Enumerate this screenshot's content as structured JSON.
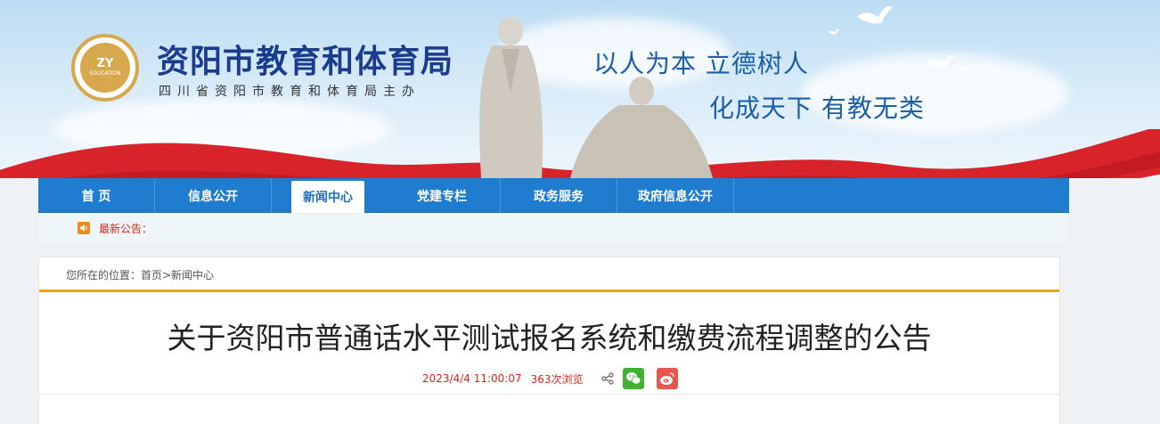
{
  "header": {
    "logo_top": "ZY",
    "logo_bottom": "EDUCATION",
    "site_title": "资阳市教育和体育局",
    "site_subtitle": "四川省资阳市教育和体育局主办",
    "slogan_line1": "以人为本 立德树人",
    "slogan_line2": "化成天下 有教无类"
  },
  "nav": {
    "items": [
      {
        "label": "首 页"
      },
      {
        "label": "信息公开"
      },
      {
        "label": "新闻中心"
      },
      {
        "label": "党建专栏"
      },
      {
        "label": "政务服务"
      },
      {
        "label": "政府信息公开"
      }
    ],
    "active_index": 2
  },
  "notice": {
    "label": "最新公告："
  },
  "breadcrumb": {
    "text": "您所在的位置：首页>新闻中心"
  },
  "article": {
    "title": "关于资阳市普通话水平测试报名系统和缴费流程调整的公告",
    "datetime": "2023/4/4 11:00:07",
    "views": "363次浏览"
  },
  "icons": {
    "notice": "speaker-icon",
    "share": "share-icon",
    "wechat": "wechat-icon",
    "weibo": "weibo-icon"
  },
  "colors": {
    "nav_blue": "#1f7ccf",
    "title_blue": "#1a3c8e",
    "accent_orange": "#f5a300",
    "meta_red": "#d9261c",
    "wechat_green": "#41b035",
    "weibo_red": "#e9564d"
  }
}
